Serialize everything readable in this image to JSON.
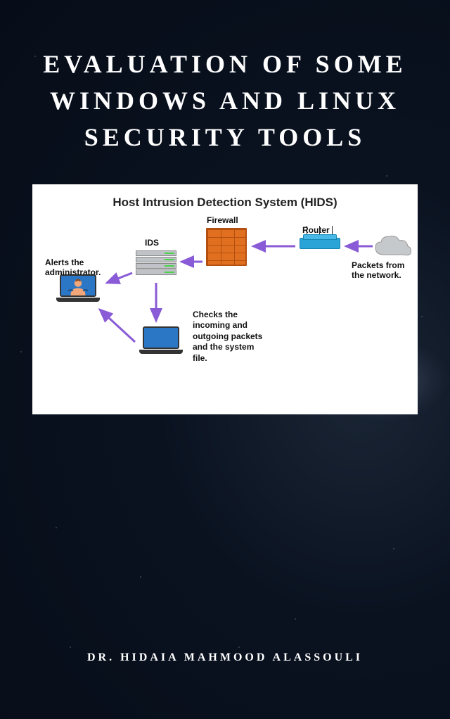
{
  "title": "EVALUATION OF SOME WINDOWS AND LINUX SECURITY TOOLS",
  "author": "DR. HIDAIA MAHMOOD ALASSOULI",
  "diagram": {
    "title": "Host Intrusion Detection System (HIDS)",
    "labels": {
      "firewall": "Firewall",
      "router": "Router",
      "ids": "IDS",
      "alerts": "Alerts the administrator.",
      "packets": "Packets from the network.",
      "checks": "Checks the incoming and outgoing packets and the system file."
    }
  }
}
